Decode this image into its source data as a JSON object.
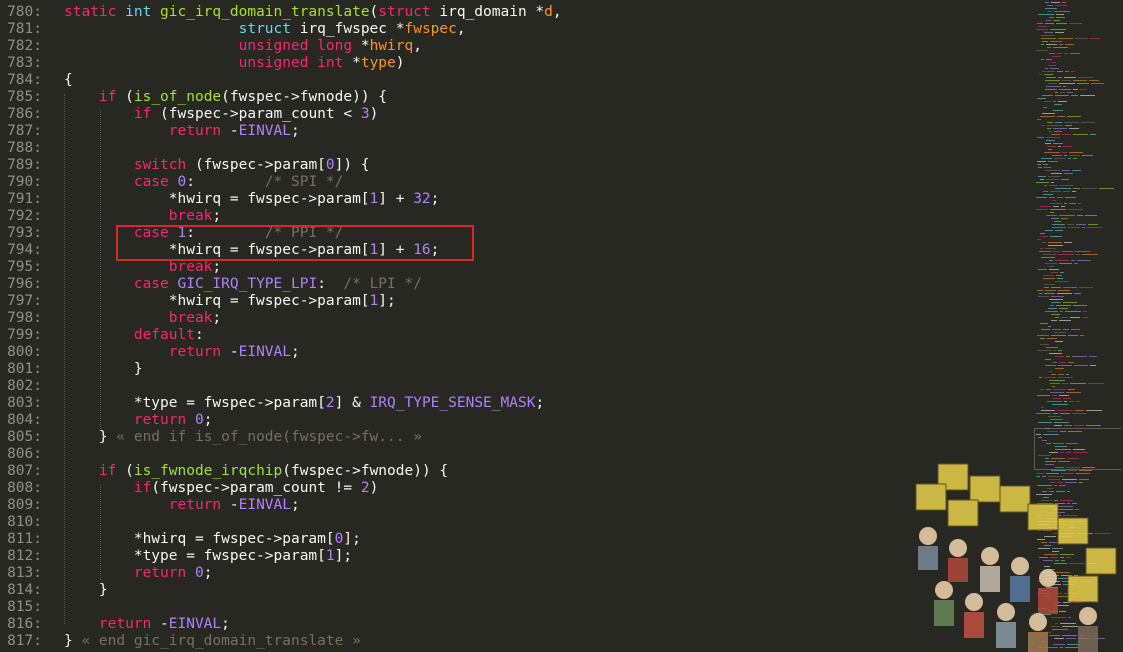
{
  "lines": [
    {
      "n": "780:",
      "t": [
        [
          "kw",
          "static "
        ],
        [
          "ty",
          "int "
        ],
        [
          "fn",
          "gic_irq_domain_translate"
        ],
        [
          "",
          "("
        ],
        [
          "kw",
          "struct "
        ],
        [
          "",
          "irq_domain *"
        ],
        [
          "pr",
          "d"
        ],
        [
          "",
          ","
        ]
      ]
    },
    {
      "n": "781:",
      "t": [
        [
          "",
          "                    "
        ],
        [
          "ty",
          "struct "
        ],
        [
          "",
          "irq_fwspec *"
        ],
        [
          "pr",
          "fwspec"
        ],
        [
          "",
          ","
        ]
      ]
    },
    {
      "n": "782:",
      "t": [
        [
          "",
          "                    "
        ],
        [
          "kw",
          "unsigned long "
        ],
        [
          "",
          "*"
        ],
        [
          "pr",
          "hwirq"
        ],
        [
          "",
          ","
        ]
      ]
    },
    {
      "n": "783:",
      "t": [
        [
          "",
          "                    "
        ],
        [
          "kw",
          "unsigned int "
        ],
        [
          "",
          "*"
        ],
        [
          "pr",
          "type"
        ],
        [
          "",
          ")"
        ]
      ]
    },
    {
      "n": "784:",
      "t": [
        [
          "",
          "{"
        ]
      ]
    },
    {
      "n": "785:",
      "t": [
        [
          "",
          "    "
        ],
        [
          "kw",
          "if "
        ],
        [
          "",
          "("
        ],
        [
          "fn",
          "is_of_node"
        ],
        [
          "",
          "(fwspec->fwnode)) {"
        ]
      ]
    },
    {
      "n": "786:",
      "t": [
        [
          "",
          "        "
        ],
        [
          "kw",
          "if "
        ],
        [
          "",
          "(fwspec->param_count < "
        ],
        [
          "nm",
          "3"
        ],
        [
          "",
          ")"
        ]
      ]
    },
    {
      "n": "787:",
      "t": [
        [
          "",
          "            "
        ],
        [
          "kw",
          "return "
        ],
        [
          "",
          "-"
        ],
        [
          "co",
          "EINVAL"
        ],
        [
          "",
          ";"
        ]
      ]
    },
    {
      "n": "788:",
      "t": []
    },
    {
      "n": "789:",
      "t": [
        [
          "",
          "        "
        ],
        [
          "kw",
          "switch "
        ],
        [
          "",
          "(fwspec->param["
        ],
        [
          "nm",
          "0"
        ],
        [
          "",
          "]) {"
        ]
      ]
    },
    {
      "n": "790:",
      "t": [
        [
          "",
          "        "
        ],
        [
          "kw",
          "case "
        ],
        [
          "nm",
          "0"
        ],
        [
          "",
          ":        "
        ],
        [
          "cm",
          "/* SPI */"
        ]
      ]
    },
    {
      "n": "791:",
      "t": [
        [
          "",
          "            *hwirq = fwspec->param["
        ],
        [
          "nm",
          "1"
        ],
        [
          "",
          "] + "
        ],
        [
          "nm",
          "32"
        ],
        [
          "",
          ";"
        ]
      ]
    },
    {
      "n": "792:",
      "t": [
        [
          "",
          "            "
        ],
        [
          "kw",
          "break"
        ],
        [
          "",
          ";"
        ]
      ]
    },
    {
      "n": "793:",
      "t": [
        [
          "",
          "        "
        ],
        [
          "kw",
          "case "
        ],
        [
          "nm",
          "1"
        ],
        [
          "",
          ":        "
        ],
        [
          "cm",
          "/* PPI */"
        ]
      ]
    },
    {
      "n": "794:",
      "t": [
        [
          "",
          "            *hwirq = fwspec->param["
        ],
        [
          "nm",
          "1"
        ],
        [
          "",
          "] + "
        ],
        [
          "nm",
          "16"
        ],
        [
          "",
          ";"
        ]
      ]
    },
    {
      "n": "795:",
      "t": [
        [
          "",
          "            "
        ],
        [
          "kw",
          "break"
        ],
        [
          "",
          ";"
        ]
      ]
    },
    {
      "n": "796:",
      "t": [
        [
          "",
          "        "
        ],
        [
          "kw",
          "case "
        ],
        [
          "co",
          "GIC_IRQ_TYPE_LPI"
        ],
        [
          "",
          ":  "
        ],
        [
          "cm",
          "/* LPI */"
        ]
      ]
    },
    {
      "n": "797:",
      "t": [
        [
          "",
          "            *hwirq = fwspec->param["
        ],
        [
          "nm",
          "1"
        ],
        [
          "",
          "];"
        ]
      ]
    },
    {
      "n": "798:",
      "t": [
        [
          "",
          "            "
        ],
        [
          "kw",
          "break"
        ],
        [
          "",
          ";"
        ]
      ]
    },
    {
      "n": "799:",
      "t": [
        [
          "",
          "        "
        ],
        [
          "kw",
          "default"
        ],
        [
          "",
          ":"
        ]
      ]
    },
    {
      "n": "800:",
      "t": [
        [
          "",
          "            "
        ],
        [
          "kw",
          "return "
        ],
        [
          "",
          "-"
        ],
        [
          "co",
          "EINVAL"
        ],
        [
          "",
          ";"
        ]
      ]
    },
    {
      "n": "801:",
      "t": [
        [
          "",
          "        }"
        ]
      ]
    },
    {
      "n": "802:",
      "t": []
    },
    {
      "n": "803:",
      "t": [
        [
          "",
          "        *type = fwspec->param["
        ],
        [
          "nm",
          "2"
        ],
        [
          "",
          "] & "
        ],
        [
          "co",
          "IRQ_TYPE_SENSE_MASK"
        ],
        [
          "",
          ";"
        ]
      ]
    },
    {
      "n": "804:",
      "t": [
        [
          "",
          "        "
        ],
        [
          "kw",
          "return "
        ],
        [
          "nm",
          "0"
        ],
        [
          "",
          ";"
        ]
      ]
    },
    {
      "n": "805:",
      "t": [
        [
          "",
          "    } "
        ],
        [
          "fold",
          "« end if is_of_node(fwspec->fw... »"
        ]
      ]
    },
    {
      "n": "806:",
      "t": []
    },
    {
      "n": "807:",
      "t": [
        [
          "",
          "    "
        ],
        [
          "kw",
          "if "
        ],
        [
          "",
          "("
        ],
        [
          "fn",
          "is_fwnode_irqchip"
        ],
        [
          "",
          "(fwspec->fwnode)) {"
        ]
      ]
    },
    {
      "n": "808:",
      "t": [
        [
          "",
          "        "
        ],
        [
          "kw",
          "if"
        ],
        [
          "",
          "(fwspec->param_count != "
        ],
        [
          "nm",
          "2"
        ],
        [
          "",
          ")"
        ]
      ]
    },
    {
      "n": "809:",
      "t": [
        [
          "",
          "            "
        ],
        [
          "kw",
          "return "
        ],
        [
          "",
          "-"
        ],
        [
          "co",
          "EINVAL"
        ],
        [
          "",
          ";"
        ]
      ]
    },
    {
      "n": "810:",
      "t": []
    },
    {
      "n": "811:",
      "t": [
        [
          "",
          "        *hwirq = fwspec->param["
        ],
        [
          "nm",
          "0"
        ],
        [
          "",
          "];"
        ]
      ]
    },
    {
      "n": "812:",
      "t": [
        [
          "",
          "        *type = fwspec->param["
        ],
        [
          "nm",
          "1"
        ],
        [
          "",
          "];"
        ]
      ]
    },
    {
      "n": "813:",
      "t": [
        [
          "",
          "        "
        ],
        [
          "kw",
          "return "
        ],
        [
          "nm",
          "0"
        ],
        [
          "",
          ";"
        ]
      ]
    },
    {
      "n": "814:",
      "t": [
        [
          "",
          "    }"
        ]
      ]
    },
    {
      "n": "815:",
      "t": []
    },
    {
      "n": "816:",
      "t": [
        [
          "",
          "    "
        ],
        [
          "kw",
          "return "
        ],
        [
          "",
          "-"
        ],
        [
          "co",
          "EINVAL"
        ],
        [
          "",
          ";"
        ]
      ]
    },
    {
      "n": "817:",
      "t": [
        [
          "",
          "} "
        ],
        [
          "fold",
          "« end gic_irq_domain_translate »"
        ]
      ]
    }
  ],
  "colors": {
    "background": "#272822",
    "highlight_box": "#d8282c"
  }
}
